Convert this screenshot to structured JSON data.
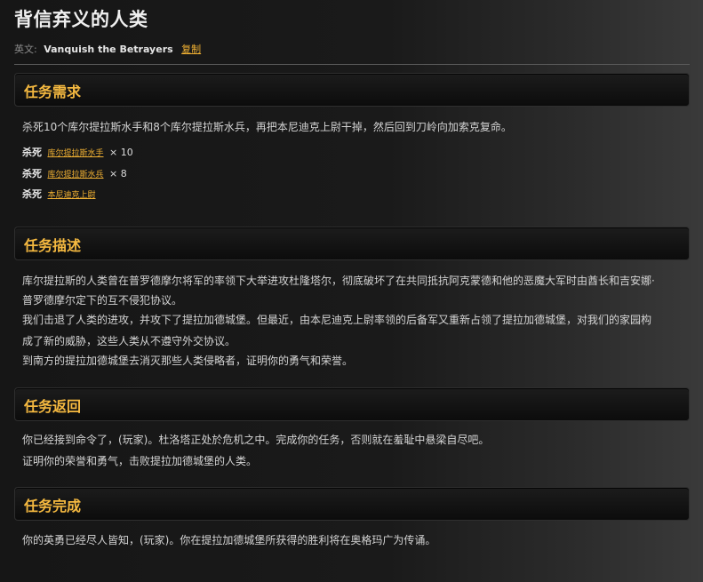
{
  "quest": {
    "title": "背信弃义的人类",
    "english_label": "英文:",
    "english_name": "Vanquish the Betrayers",
    "copy_label": "复制"
  },
  "requirements": {
    "header": "任务需求",
    "text": "杀死10个库尔提拉斯水手和8个库尔提拉斯水兵，再把本尼迪克上尉干掉，然后回到刀岭向加索克复命。",
    "kills": [
      {
        "verb": "杀死",
        "target": "库尔提拉斯水手",
        "count": "× 10"
      },
      {
        "verb": "杀死",
        "target": "库尔提拉斯水兵",
        "count": "× 8"
      },
      {
        "verb": "杀死",
        "target": "本尼迪克上尉",
        "count": ""
      }
    ]
  },
  "description": {
    "header": "任务描述",
    "lines": [
      "库尔提拉斯的人类曾在普罗德摩尔将军的率领下大举进攻杜隆塔尔，彻底破坏了在共同抵抗阿克蒙德和他的恶魔大军时由酋长和吉安娜·",
      "普罗德摩尔定下的互不侵犯协议。",
      "我们击退了人类的进攻，并攻下了提拉加德城堡。但最近，由本尼迪克上尉率领的后备军又重新占领了提拉加德城堡，对我们的家园构",
      "成了新的威胁，这些人类从不遵守外交协议。",
      "到南方的提拉加德城堡去消灭那些人类侵略者，证明你的勇气和荣誉。"
    ]
  },
  "return": {
    "header": "任务返回",
    "lines": [
      "你已经接到命令了，(玩家)。杜洛塔正处於危机之中。完成你的任务，否则就在羞耻中悬梁自尽吧。",
      "证明你的荣誉和勇气，击败提拉加德城堡的人类。"
    ]
  },
  "completion": {
    "header": "任务完成",
    "lines": [
      "你的英勇已经尽人皆知，(玩家)。你在提拉加德城堡所获得的胜利将在奥格玛广为传诵。"
    ]
  },
  "colors": {
    "accent": "#f5b940",
    "link": "#f2b233",
    "text": "#d4d4d4",
    "background": "#161616"
  }
}
